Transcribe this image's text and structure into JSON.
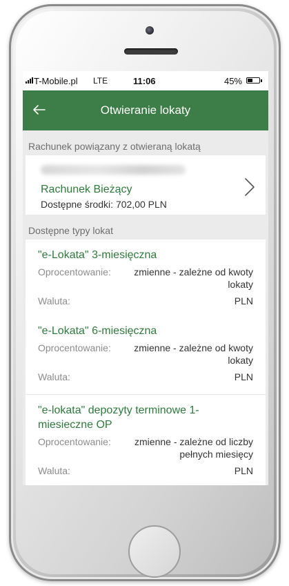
{
  "status_bar": {
    "carrier": "T-Mobile.pl",
    "network": "LTE",
    "time": "11:06",
    "battery": "45%",
    "battery_level": 0.45
  },
  "header": {
    "title": "Otwieranie lokaty",
    "back_icon": "arrow-left-icon"
  },
  "linked_account": {
    "section_label": "Rachunek powiązany z otwieraną lokatą",
    "name": "Rachunek Bieżący",
    "funds": "Dostępne środki: 702,00 PLN",
    "chevron_icon": "chevron-right-icon"
  },
  "deposits": {
    "section_label": "Dostępne typy lokat",
    "rate_label": "Oprocentowanie:",
    "currency_label": "Waluta:",
    "items": [
      {
        "name": "\"e-Lokata\" 3-miesięczna",
        "rate": "zmienne - zależne od kwoty lokaty",
        "currency": "PLN"
      },
      {
        "name": "\"e-Lokata\" 6-miesięczna",
        "rate": "zmienne - zależne od kwoty lokaty",
        "currency": "PLN"
      },
      {
        "name": "\"e-lokata\" depozyty terminowe 1-miesieczne OP",
        "rate": "zmienne - zależne od liczby pełnych miesięcy",
        "currency": "PLN"
      }
    ]
  },
  "colors": {
    "header_bg": "#3d7d47",
    "accent_text": "#2f7a3c",
    "screen_bg": "#ebebeb"
  }
}
